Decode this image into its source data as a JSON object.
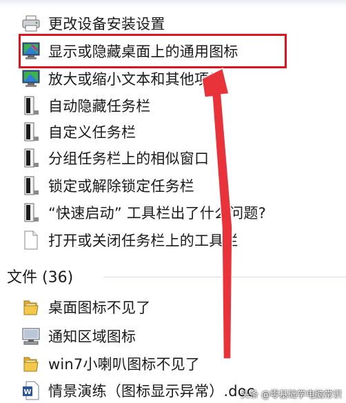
{
  "settings_results": [
    {
      "label": "更改设备安装设置",
      "icon": "printer-icon"
    },
    {
      "label": "显示或隐藏桌面上的通用图标",
      "icon": "display-icon"
    },
    {
      "label": "放大或缩小文本和其他项目",
      "icon": "display-icon"
    },
    {
      "label": "自动隐藏任务栏",
      "icon": "taskbar-icon"
    },
    {
      "label": "自定义任务栏",
      "icon": "taskbar-icon"
    },
    {
      "label": "分组任务栏上的相似窗口",
      "icon": "taskbar-icon"
    },
    {
      "label": "锁定或解除锁定任务栏",
      "icon": "taskbar-icon"
    },
    {
      "label": "“快速启动” 工具栏出了什么问题?",
      "icon": "taskbar-icon"
    },
    {
      "label": "打开或关闭任务栏上的工具栏",
      "icon": "document-icon"
    }
  ],
  "files_section": {
    "header": "文件 (36)",
    "items": [
      {
        "label": "桌面图标不见了",
        "icon": "folder-icon"
      },
      {
        "label": "通知区域图标",
        "icon": "computer-icon"
      },
      {
        "label": "win7小喇叭图标不见了",
        "icon": "folder-icon"
      },
      {
        "label": "情景演练（图标显示异常）.doc",
        "icon": "word-document-icon"
      }
    ]
  },
  "watermark": "头条 @零基础学电脑常识",
  "colors": {
    "highlight": "#e0141e",
    "arrow": "#e8333a"
  }
}
